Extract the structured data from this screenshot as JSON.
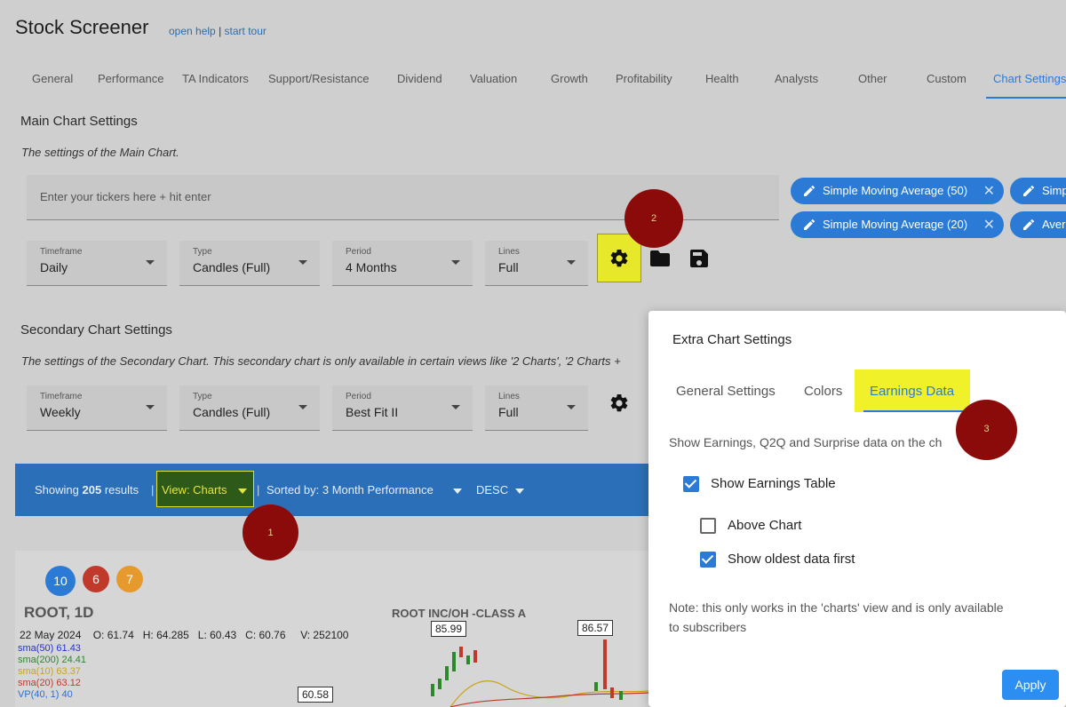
{
  "app": {
    "title": "Stock Screener",
    "help_link": "open help",
    "separator": "|",
    "tour_link": "start tour"
  },
  "tabs": [
    "General",
    "Performance",
    "TA Indicators",
    "Support/Resistance",
    "Dividend",
    "Valuation",
    "Growth",
    "Profitability",
    "Health",
    "Analysts",
    "Other",
    "Custom",
    "Chart Settings"
  ],
  "active_tab": "Chart Settings",
  "main_chart": {
    "heading": "Main Chart Settings",
    "description": "The settings of the Main Chart.",
    "ticker_placeholder": "Enter your tickers here + hit enter",
    "timeframe_label": "Timeframe",
    "timeframe_value": "Daily",
    "type_label": "Type",
    "type_value": "Candles (Full)",
    "period_label": "Period",
    "period_value": "4 Months",
    "lines_label": "Lines",
    "lines_value": "Full"
  },
  "indicator_chips": [
    {
      "label": "Simple Moving Average (50)"
    },
    {
      "label": "Simple Moving Average (20)"
    },
    {
      "label": "Simp"
    },
    {
      "label": "Aver"
    }
  ],
  "secondary_chart": {
    "heading": "Secondary Chart Settings",
    "description": "The settings of the Secondary Chart. This secondary chart is only available in certain views like '2 Charts', '2 Charts +",
    "timeframe_label": "Timeframe",
    "timeframe_value": "Weekly",
    "type_label": "Type",
    "type_value": "Candles (Full)",
    "period_label": "Period",
    "period_value": "Best Fit II",
    "lines_label": "Lines",
    "lines_value": "Full"
  },
  "results_bar": {
    "showing_prefix": "Showing",
    "count": "205",
    "showing_suffix": "results",
    "view_label": "View: Charts",
    "sorted_label": "Sorted by: 3 Month Performance",
    "order_label": "DESC"
  },
  "markers": [
    "1",
    "2",
    "3"
  ],
  "chart_card": {
    "badges": [
      "10",
      "6",
      "7"
    ],
    "symbol": "ROOT, 1D",
    "company": "ROOT INC/OH -CLASS A",
    "ohlc_line": "22 May 2024    O: 61.74   H: 64.285   L: 60.43   C: 60.76     V: 252100",
    "legend": [
      {
        "text": "sma(50) 61.43",
        "color": "#2233cc"
      },
      {
        "text": "sma(200) 24.41",
        "color": "#2a8a2a"
      },
      {
        "text": "sma(10) 63.37",
        "color": "#c9a41a"
      },
      {
        "text": "sma(20) 63.12",
        "color": "#c0392b"
      },
      {
        "text": "VP(40, 1) 40",
        "color": "#2b6fd6"
      }
    ],
    "price_tags": [
      "85.99",
      "86.57",
      "60.58"
    ]
  },
  "modal": {
    "title": "Extra Chart Settings",
    "tabs": [
      "General Settings",
      "Colors",
      "Earnings Data"
    ],
    "active_tab": "Earnings Data",
    "description": "Show Earnings, Q2Q and Surprise data on the ch",
    "show_table_label": "Show Earnings Table",
    "show_table_checked": true,
    "above_chart_label": "Above Chart",
    "above_chart_checked": false,
    "oldest_first_label": "Show oldest data first",
    "oldest_first_checked": true,
    "note": "Note: this only works in the 'charts' view and is only available to subscribers",
    "apply_label": "Apply"
  },
  "colors": {
    "accent": "#2b7bd6",
    "highlight": "#e8e82a",
    "marker": "#8b0a0a",
    "results_bar": "#2b6fb8"
  }
}
